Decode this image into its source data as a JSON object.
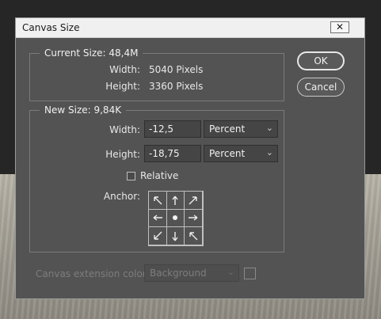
{
  "dialog": {
    "title": "Canvas Size",
    "close_glyph": "✕"
  },
  "current_size": {
    "legend": "Current Size: 48,4M",
    "width_label": "Width:",
    "width_value": "5040 Pixels",
    "height_label": "Height:",
    "height_value": "3360 Pixels"
  },
  "new_size": {
    "legend": "New Size: 9,84K",
    "width_label": "Width:",
    "width_value": "-12,5",
    "width_unit": "Percent",
    "height_label": "Height:",
    "height_value": "-18,75",
    "height_unit": "Percent",
    "relative_label": "Relative",
    "relative_checked": false,
    "anchor_label": "Anchor:",
    "anchor_position": "center"
  },
  "extension": {
    "label": "Canvas extension color:",
    "value": "Background",
    "enabled": false
  },
  "buttons": {
    "ok": "OK",
    "cancel": "Cancel"
  },
  "icons": {
    "anchor_arrows": [
      "arrow-nw-icon",
      "arrow-n-icon",
      "arrow-ne-icon",
      "arrow-w-icon",
      "anchor-dot-icon",
      "arrow-e-icon",
      "arrow-sw-icon",
      "arrow-s-icon",
      "arrow-se-icon"
    ]
  }
}
